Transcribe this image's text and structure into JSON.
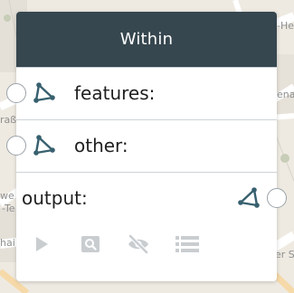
{
  "node": {
    "title": "Within",
    "inputs": [
      {
        "label": "features:",
        "type_icon": "polygon-geometry-icon"
      },
      {
        "label": "other:",
        "type_icon": "polygon-geometry-icon"
      }
    ],
    "output": {
      "label": "output:",
      "type_icon": "polygon-geometry-icon"
    },
    "controls": [
      {
        "name": "play-icon",
        "enabled": false
      },
      {
        "name": "inspect-icon",
        "enabled": false
      },
      {
        "name": "visibility-off-icon",
        "enabled": false
      },
      {
        "name": "list-icon",
        "enabled": false
      }
    ]
  },
  "map_labels": {
    "top_right": "-He",
    "mid_right": "ena",
    "left_upper": "raße",
    "left_mid": "-Te",
    "left_mid2": "we",
    "left_lower": "hai",
    "bottom_right": "er S"
  },
  "colors": {
    "header_bg": "#37474f",
    "icon": "#37606f",
    "disabled_control": "#c9cdd0"
  }
}
